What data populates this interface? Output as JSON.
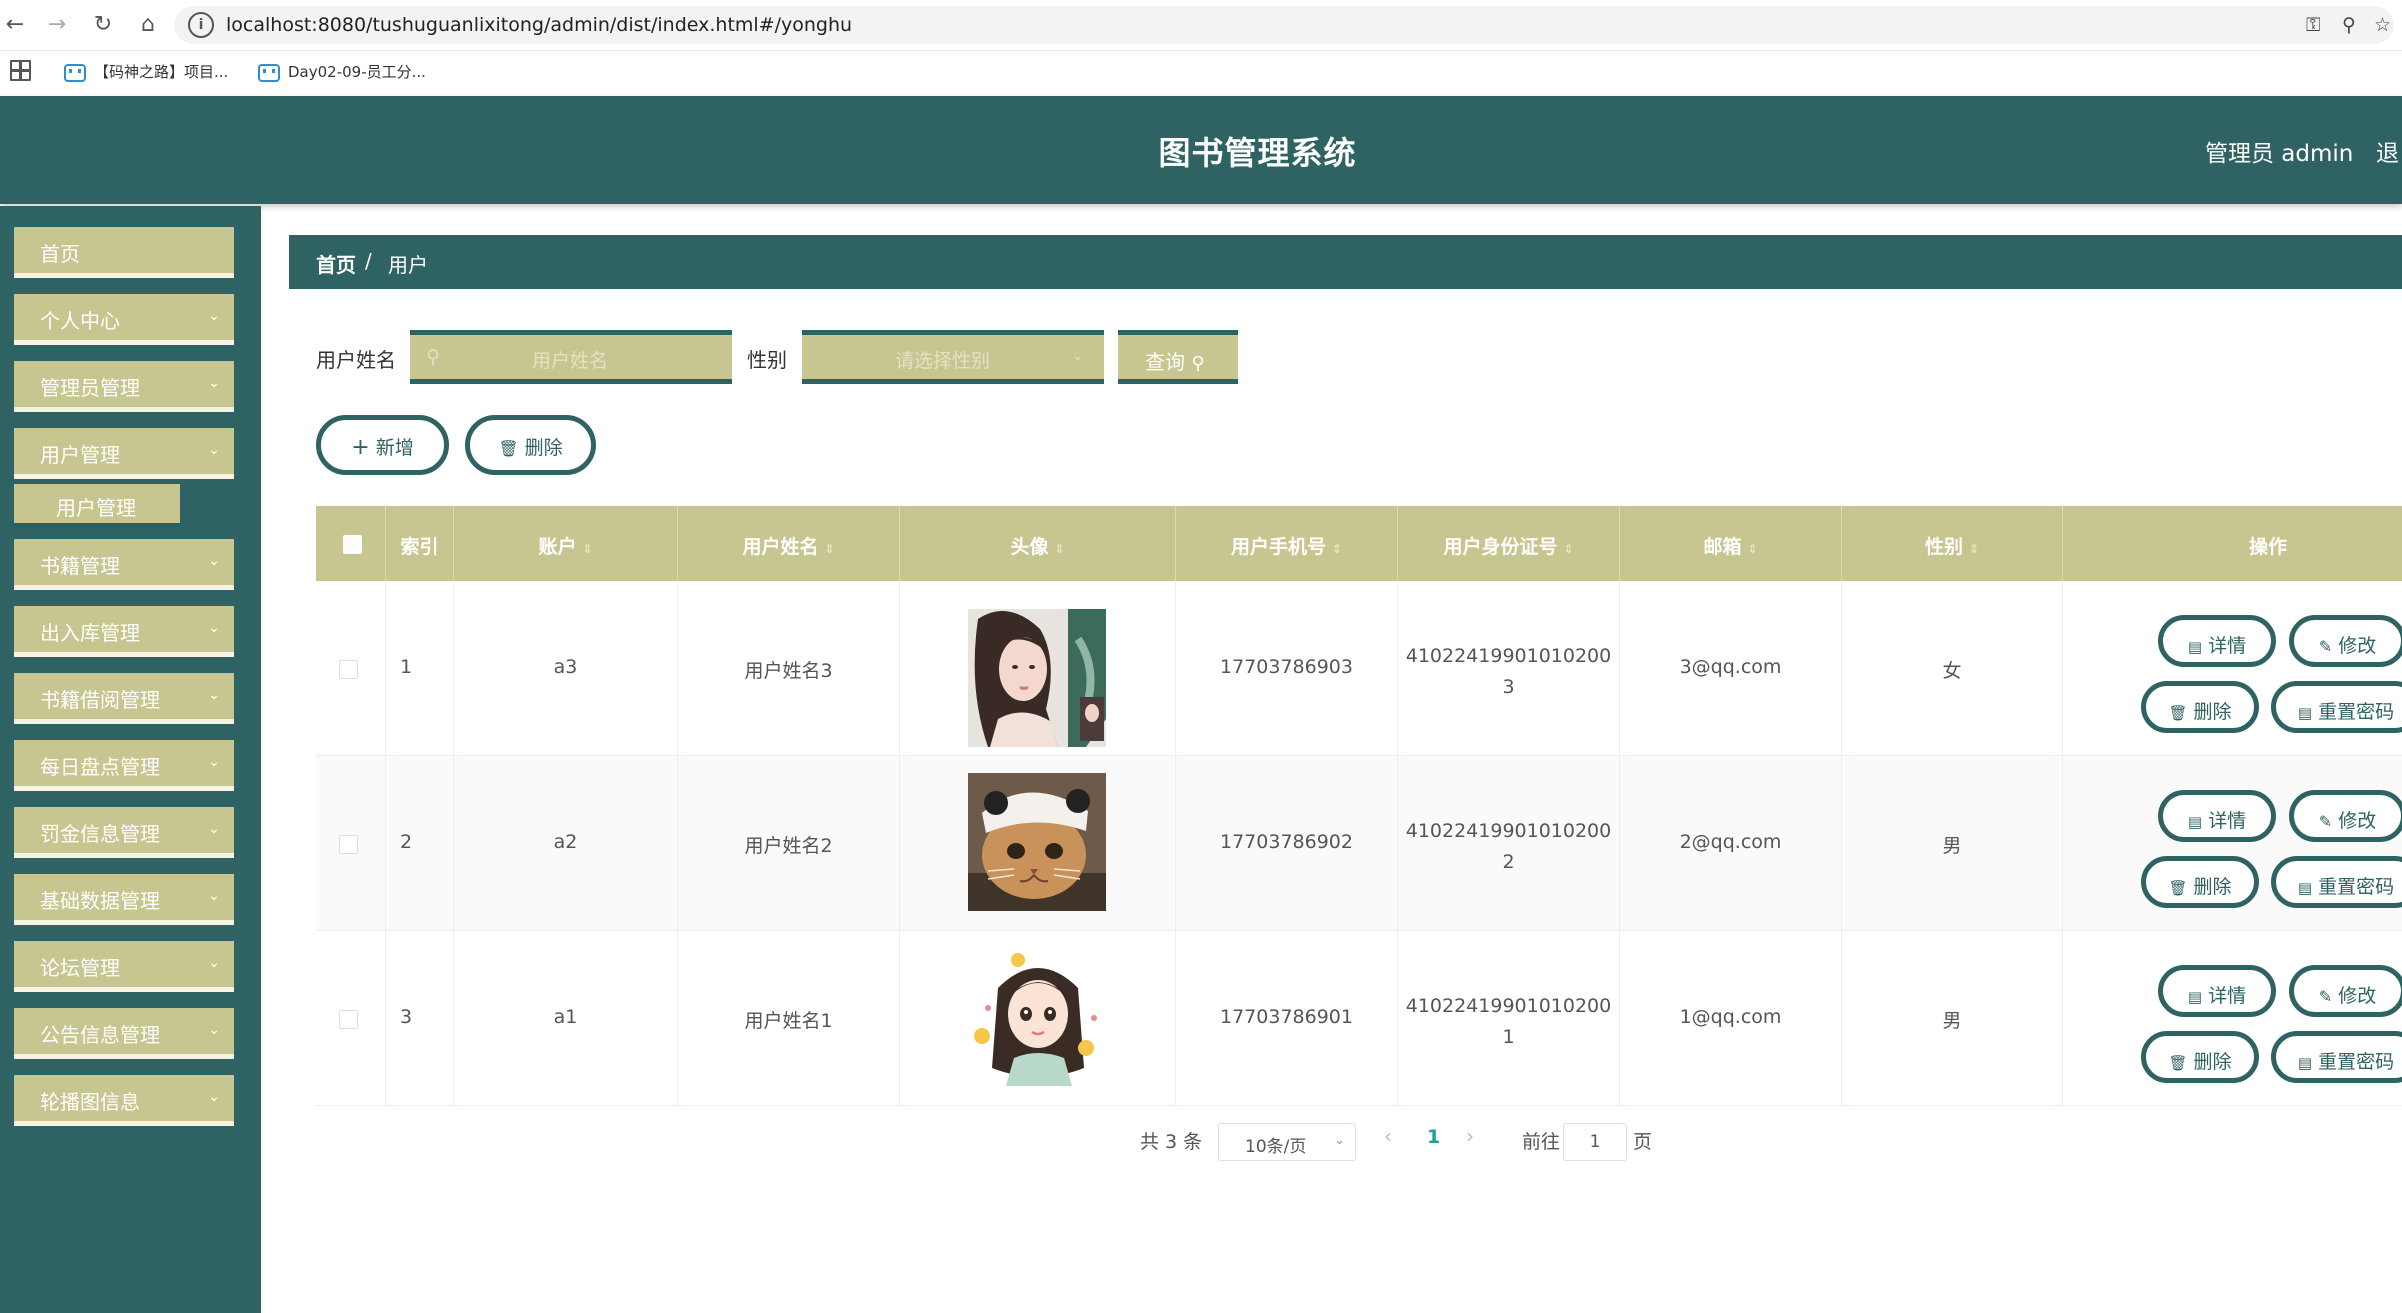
{
  "browser": {
    "url": "localhost:8080/tushuguanlixitong/admin/dist/index.html#/yonghu",
    "bookmarks": [
      "【码神之路】项目...",
      "Day02-09-员工分..."
    ]
  },
  "header": {
    "title": "图书管理系统",
    "admin": "管理员 admin",
    "logout": "退"
  },
  "sidebar": {
    "items": [
      {
        "label": "首页"
      },
      {
        "label": "个人中心"
      },
      {
        "label": "管理员管理"
      },
      {
        "label": "用户管理"
      },
      {
        "label": "书籍管理"
      },
      {
        "label": "出入库管理"
      },
      {
        "label": "书籍借阅管理"
      },
      {
        "label": "每日盘点管理"
      },
      {
        "label": "罚金信息管理"
      },
      {
        "label": "基础数据管理"
      },
      {
        "label": "论坛管理"
      },
      {
        "label": "公告信息管理"
      },
      {
        "label": "轮播图信息"
      }
    ],
    "sub_item": "用户管理"
  },
  "breadcrumb": {
    "home": "首页",
    "sep": "/",
    "current": "用户"
  },
  "search": {
    "name_label": "用户姓名",
    "name_placeholder": "用户姓名",
    "gender_label": "性别",
    "gender_placeholder": "请选择性别",
    "query_label": "查询"
  },
  "actions": {
    "add": "新增",
    "delete": "删除"
  },
  "table": {
    "headers": {
      "index": "索引",
      "account": "账户",
      "name": "用户姓名",
      "avatar": "头像",
      "phone": "用户手机号",
      "idcard": "用户身份证号",
      "email": "邮箱",
      "gender": "性别",
      "ops": "操作"
    },
    "rows": [
      {
        "index": "1",
        "account": "a3",
        "name": "用户姓名3",
        "phone": "17703786903",
        "id1": "41022419901010200",
        "id2": "3",
        "email": "3@qq.com",
        "gender": "女"
      },
      {
        "index": "2",
        "account": "a2",
        "name": "用户姓名2",
        "phone": "17703786902",
        "id1": "41022419901010200",
        "id2": "2",
        "email": "2@qq.com",
        "gender": "男"
      },
      {
        "index": "3",
        "account": "a1",
        "name": "用户姓名1",
        "phone": "17703786901",
        "id1": "41022419901010200",
        "id2": "1",
        "email": "1@qq.com",
        "gender": "男"
      }
    ],
    "ops": {
      "detail": "详情",
      "edit": "修改",
      "delete": "删除",
      "reset": "重置密码"
    }
  },
  "pagination": {
    "total": "共 3 条",
    "page_size": "10条/页",
    "current": "1",
    "goto": "前往",
    "goto_value": "1",
    "page_unit": "页"
  }
}
